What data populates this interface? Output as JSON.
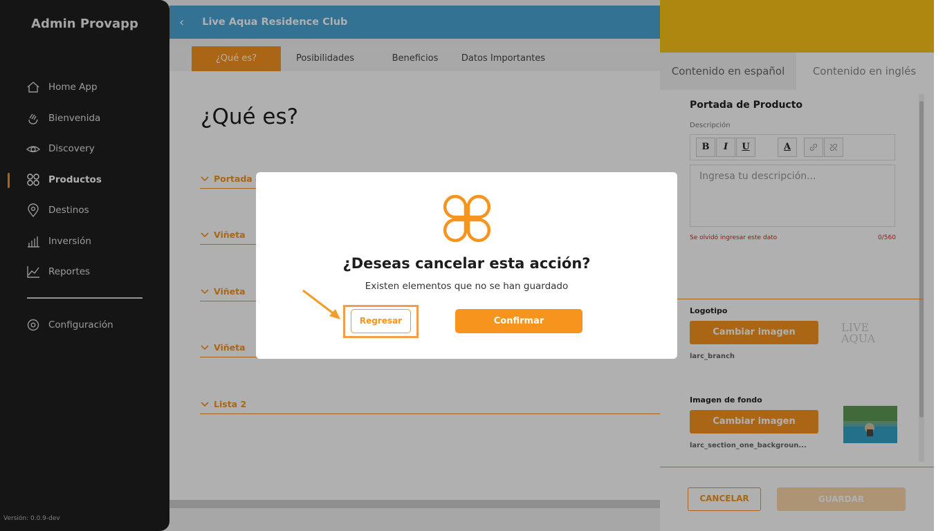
{
  "sidebar": {
    "brand": "Admin Provapp",
    "items": [
      {
        "label": "Home App",
        "icon": "house-icon"
      },
      {
        "label": "Bienvenida",
        "icon": "waving-hand-icon"
      },
      {
        "label": "Discovery",
        "icon": "eye-icon"
      },
      {
        "label": "Productos",
        "icon": "grid-icon"
      },
      {
        "label": "Destinos",
        "icon": "map-pin-icon"
      },
      {
        "label": "Inversión",
        "icon": "bar-chart-icon"
      },
      {
        "label": "Reportes",
        "icon": "line-chart-icon"
      }
    ],
    "settings_label": "Configuración",
    "version": "Versión: 0.0.9-dev"
  },
  "topbar": {
    "title": "Live Aqua Residence Club"
  },
  "tabs": [
    "¿Qué es?",
    "Posibilidades",
    "Beneficios",
    "Datos Importantes"
  ],
  "main": {
    "page_title": "¿Qué es?",
    "sections": [
      "Portada d",
      "Viñeta",
      "Viñeta",
      "Viñeta",
      "Lista 2"
    ]
  },
  "panel": {
    "tab_es": "Contenido en español",
    "tab_en": "Contenido en inglés",
    "product_cover_title": "Portada de Producto",
    "description_label": "Descripción",
    "toolbar": {
      "bold": "B",
      "italic": "I",
      "underline": "U",
      "color": "A"
    },
    "description_placeholder": "Ingresa tu descripción...",
    "error_text": "Se olvidó ingresar este dato",
    "char_count": "0/560",
    "logo_title": "Logotipo",
    "change_image_label": "Cambiar imagen",
    "logo_filename": "larc_branch",
    "bg_title": "Imagen de fondo",
    "bg_filename": "larc_section_one_backgroun...",
    "logo_preview_text": "LIVE AQUA",
    "cancel_label": "CANCELAR",
    "save_label": "GUARDAR"
  },
  "modal": {
    "title": "¿Deseas cancelar esta acción?",
    "subtitle": "Existen elementos que no se han guardado",
    "back_label": "Regresar",
    "confirm_label": "Confirmar"
  },
  "colors": {
    "accent": "#f7941d",
    "sidebar_bg": "#1f1f1f",
    "topbar_bg": "#4aa6d6",
    "panel_header": "#fcc418",
    "error": "#e02020"
  }
}
